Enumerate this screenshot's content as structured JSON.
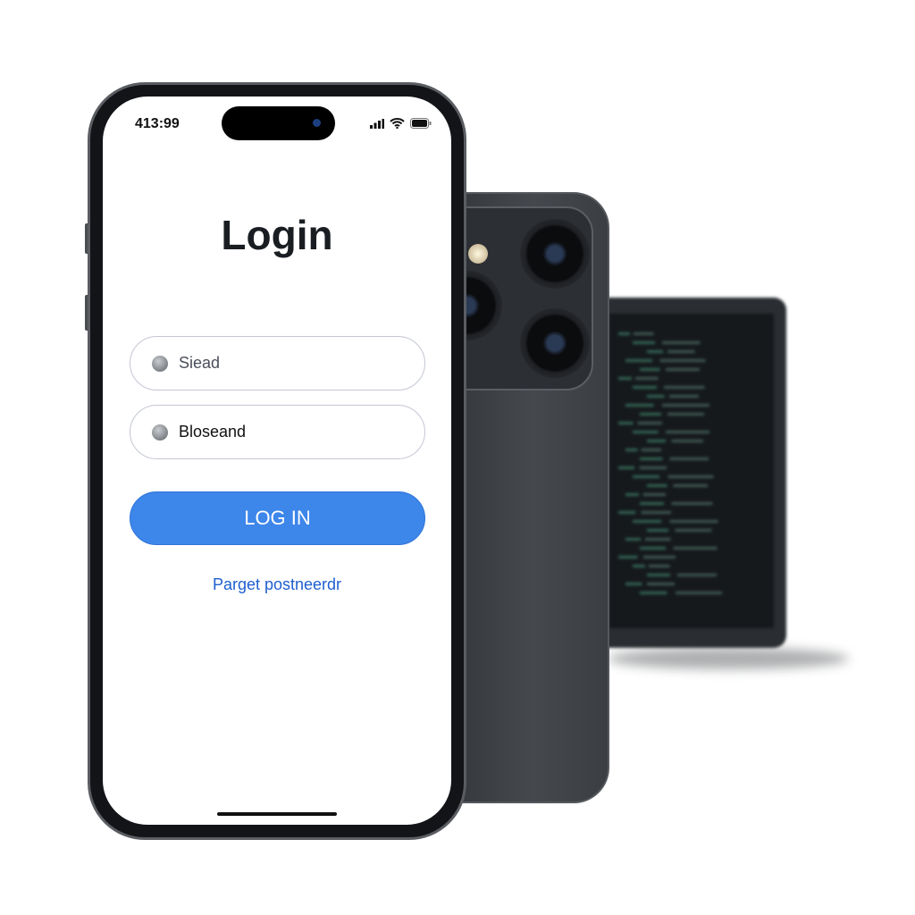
{
  "status_bar": {
    "time": "413:99",
    "icons": [
      "signal-icon",
      "wifi-icon",
      "battery-icon"
    ]
  },
  "login": {
    "title": "Login",
    "username_value": "Siead",
    "password_value": "Bloseand",
    "login_button": "LOG IN",
    "forgot_link": "Parget postneerdr"
  },
  "colors": {
    "accent": "#3d86ea",
    "link": "#1e5fcf"
  }
}
